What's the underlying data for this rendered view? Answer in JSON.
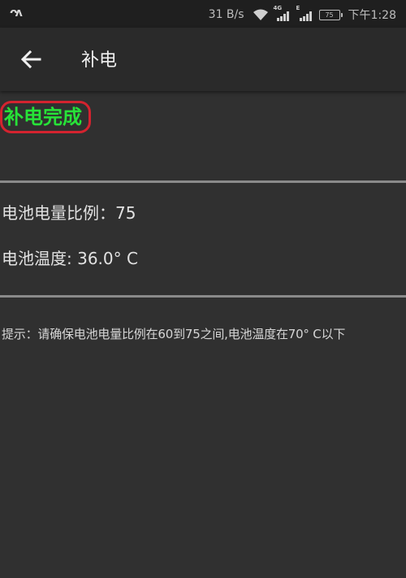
{
  "status_bar": {
    "left_icon": "ᴖᴧ",
    "net_speed": "31 B/s",
    "signal1_tag": "4G",
    "signal2_tag": "E",
    "battery": "75",
    "time": "下午1:28"
  },
  "app_bar": {
    "title": "补电"
  },
  "main": {
    "status_headline": "补电完成",
    "battery_ratio_label": "电池电量比例：",
    "battery_ratio_value": "75",
    "battery_temp_label": "电池温度: ",
    "battery_temp_value": "36.0° C",
    "hint": "提示：请确保电池电量比例在60到75之间,电池温度在70° C以下"
  },
  "colors": {
    "background": "#303030",
    "app_bar": "#2a2a2a",
    "status_bar": "#1f1f1f",
    "success_green": "#27e238",
    "annotation_red": "#d4232f",
    "divider": "#8a8a8a"
  }
}
